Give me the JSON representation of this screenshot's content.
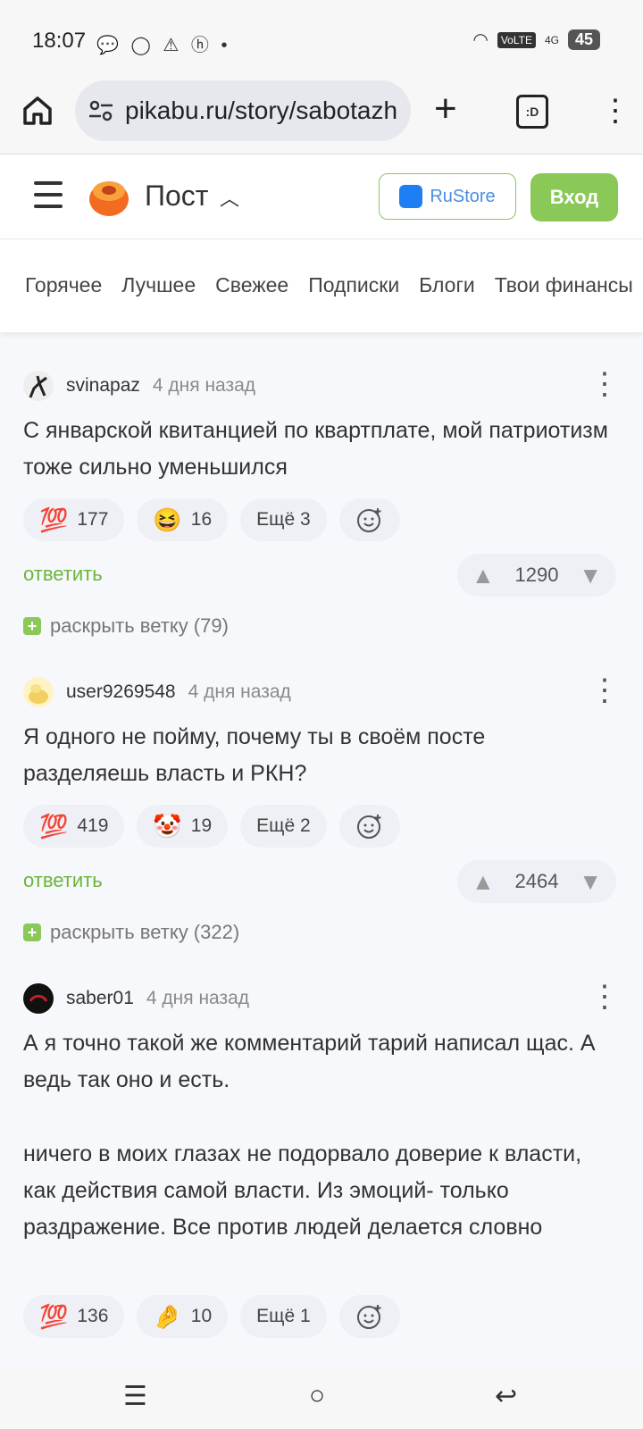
{
  "status_bar": {
    "time": "18:07",
    "network": "4G",
    "volte": "VoLTE",
    "battery": "45"
  },
  "browser": {
    "url": "pikabu.ru/story/sabotazh",
    "tab_label": ":D"
  },
  "site_header": {
    "title": "Пост",
    "rustore_label": "RuStore",
    "login_label": "Вход"
  },
  "nav": {
    "items": [
      "Горячее",
      "Лучшее",
      "Свежее",
      "Подписки",
      "Блоги",
      "Твои финансы"
    ]
  },
  "comments": [
    {
      "user": "svinapaz",
      "time": "4 дня назад",
      "text": "С январской квитанцией по квартплате, мой патриотизм тоже сильно уменьшился",
      "reactions": [
        {
          "emoji": "💯",
          "count": "177"
        },
        {
          "emoji": "😆",
          "count": "16"
        }
      ],
      "more": "Ещё 3",
      "reply": "ответить",
      "rating": "1290",
      "expand": "раскрыть ветку (79)"
    },
    {
      "user": "user9269548",
      "time": "4 дня назад",
      "text": "Я одного не пойму, почему ты в своём посте разделяешь власть и РКН?",
      "reactions": [
        {
          "emoji": "💯",
          "count": "419"
        },
        {
          "emoji": "🤡",
          "count": "19"
        }
      ],
      "more": "Ещё 2",
      "reply": "ответить",
      "rating": "2464",
      "expand": "раскрыть ветку (322)"
    },
    {
      "user": "saber01",
      "time": "4 дня назад",
      "text_p1": "А я точно такой же комментарий тарий написал щас. А ведь так оно и есть.",
      "text_p2": "ничего в моих глазах не подорвало доверие к власти, как действия самой власти. Из эмоций- только раздражение. Все против людей делается словно",
      "reactions": [
        {
          "emoji": "💯",
          "count": "136"
        },
        {
          "emoji": "🤌",
          "count": "10"
        }
      ],
      "more": "Ещё 1"
    }
  ]
}
